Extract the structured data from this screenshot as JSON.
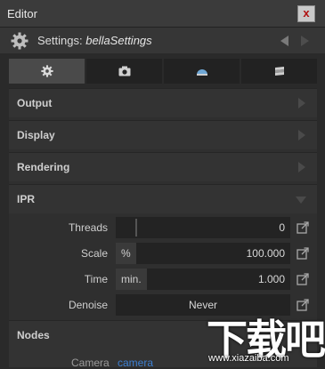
{
  "window": {
    "title": "Editor",
    "close_symbol": "x"
  },
  "settings_header": {
    "label": "Settings:",
    "object_name": "bellaSettings"
  },
  "tabs": [
    {
      "icon": "gear-icon"
    },
    {
      "icon": "camera-icon"
    },
    {
      "icon": "sky-dome-icon"
    },
    {
      "icon": "layers-icon"
    }
  ],
  "sections": {
    "output": "Output",
    "display": "Display",
    "rendering": "Rendering",
    "ipr": "IPR",
    "nodes": "Nodes"
  },
  "ipr": {
    "threads": {
      "label": "Threads",
      "value": "0"
    },
    "scale": {
      "label": "Scale",
      "unit": "%",
      "value": "100.000"
    },
    "time": {
      "label": "Time",
      "unit": "min.",
      "value": "1.000"
    },
    "denoise": {
      "label": "Denoise",
      "value": "Never"
    }
  },
  "nodes_peek": {
    "label": "Camera",
    "value": "camera"
  },
  "watermark": {
    "chinese": "下载吧",
    "url": "www.xiazaiba.com"
  },
  "colors": {
    "accent_text": "#e8e8e8",
    "close_x": "#b01010",
    "link_blue": "#3d7fd1"
  }
}
